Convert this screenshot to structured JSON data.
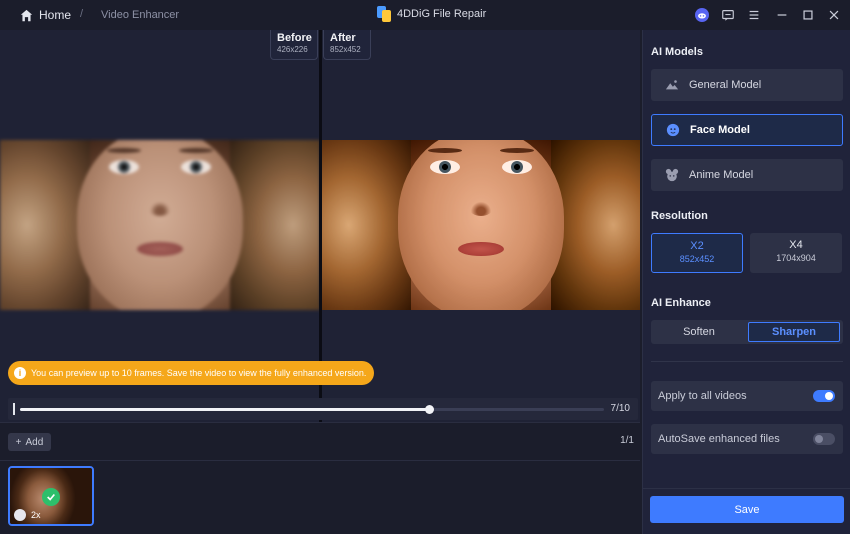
{
  "titlebar": {
    "home_label": "Home",
    "separator": "/",
    "breadcrumb": "Video Enhancer",
    "app_title": "4DDiG File Repair",
    "icons": [
      "discord-icon",
      "feedback-icon",
      "menu-icon",
      "minimize-icon",
      "maximize-icon",
      "close-icon"
    ]
  },
  "preview": {
    "before_label": "Before",
    "before_size": "426x226",
    "after_label": "After",
    "after_size": "852x452",
    "notice": "You can preview up to 10 frames. Save the video to view the fully enhanced version.",
    "timeline": {
      "current": 7,
      "total": 10,
      "counter": "7/10",
      "progress": 0.7
    }
  },
  "strip": {
    "add_label": "Add",
    "page_count": "1/1",
    "thumb_scale": "2x"
  },
  "panel": {
    "ai_models_title": "AI Models",
    "models": [
      {
        "label": "General Model",
        "icon": "landscape-icon",
        "active": false
      },
      {
        "label": "Face Model",
        "icon": "face-icon",
        "active": true
      },
      {
        "label": "Anime Model",
        "icon": "anime-icon",
        "active": false
      }
    ],
    "resolution_title": "Resolution",
    "resolutions": [
      {
        "label": "X2",
        "size": "852x452",
        "active": true
      },
      {
        "label": "X4",
        "size": "1704x904",
        "active": false
      }
    ],
    "ai_enhance_title": "AI Enhance",
    "enhance_options": [
      {
        "label": "Soften",
        "active": false
      },
      {
        "label": "Sharpen",
        "active": true
      }
    ],
    "apply_all_label": "Apply to all videos",
    "apply_all_on": true,
    "autosave_label": "AutoSave enhanced files",
    "autosave_on": false,
    "save_label": "Save"
  },
  "colors": {
    "accent": "#3e7bff",
    "notice": "#f5a71a",
    "success": "#2dbf6b",
    "background": "#1b1d2b",
    "panel": "#20233a"
  }
}
